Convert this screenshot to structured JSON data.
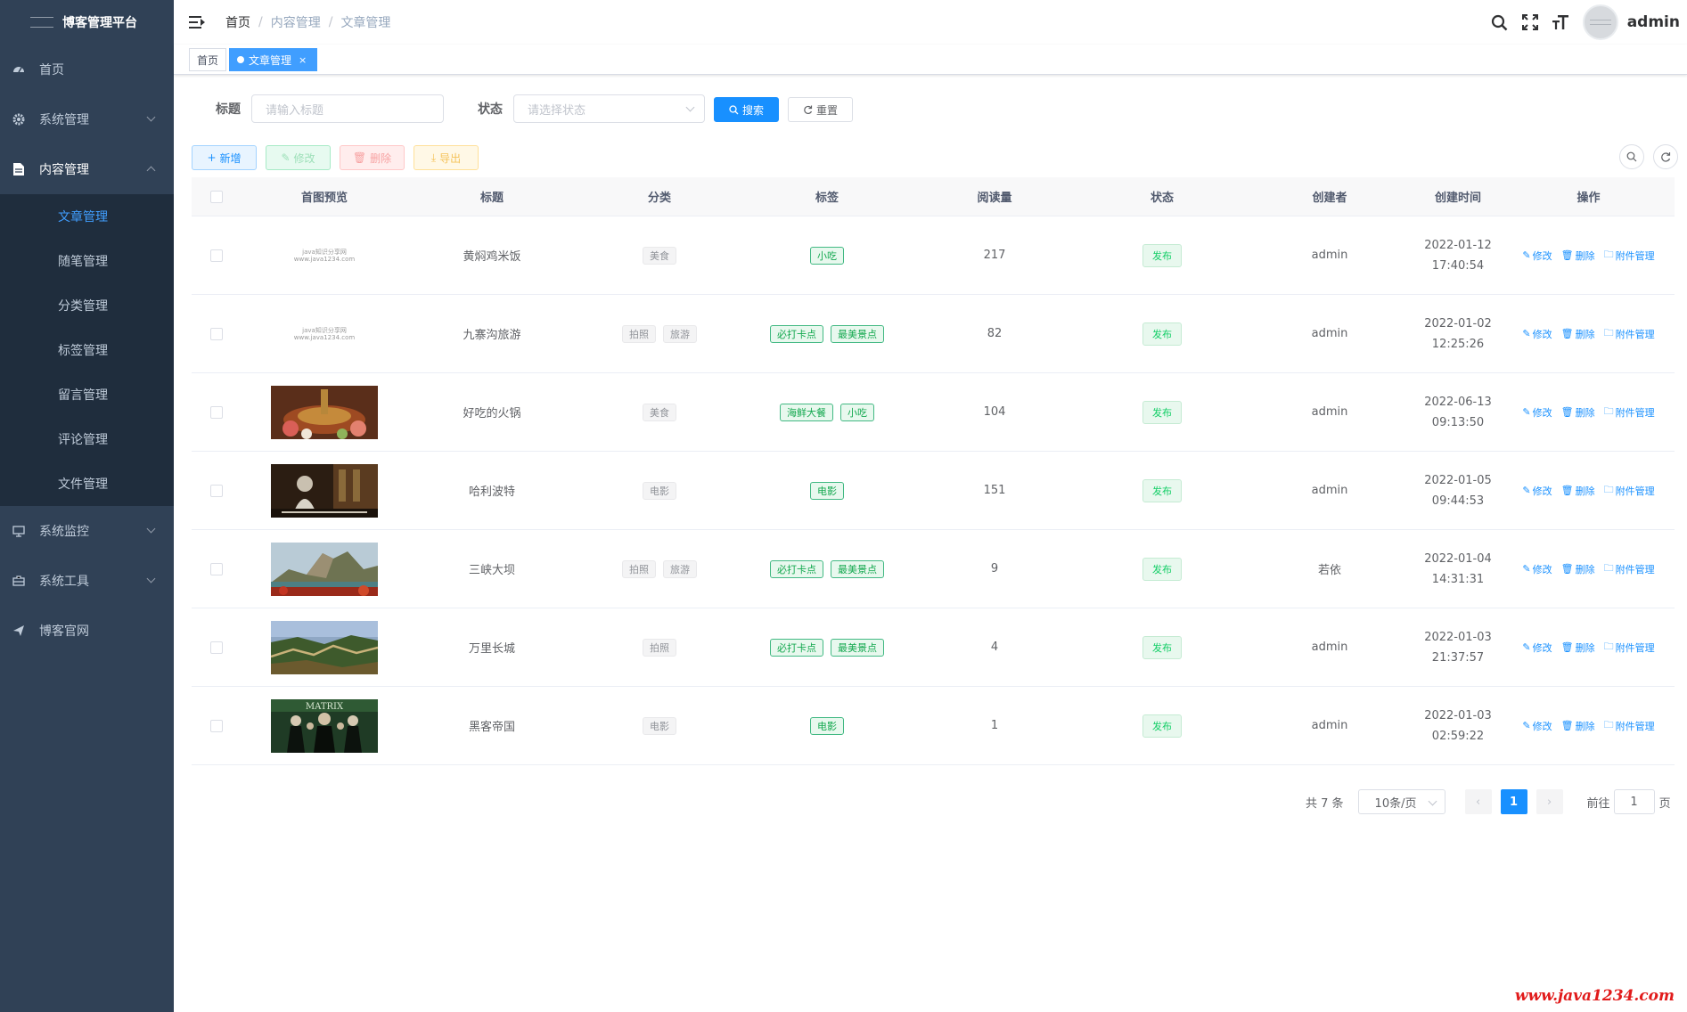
{
  "sidebar": {
    "title": "博客管理平台",
    "menu": [
      {
        "label": "首页",
        "icon": "dashboard-icon"
      },
      {
        "label": "系统管理",
        "icon": "gear-icon"
      },
      {
        "label": "内容管理",
        "icon": "document-icon"
      }
    ],
    "submenu": [
      "文章管理",
      "随笔管理",
      "分类管理",
      "标签管理",
      "留言管理",
      "评论管理",
      "文件管理"
    ],
    "menu_bottom": [
      {
        "label": "系统监控",
        "icon": "monitor-icon"
      },
      {
        "label": "系统工具",
        "icon": "toolbox-icon"
      },
      {
        "label": "博客官网",
        "icon": "send-icon"
      }
    ]
  },
  "navbar": {
    "breadcrumb": [
      "首页",
      "内容管理",
      "文章管理"
    ],
    "username": "admin"
  },
  "tags": {
    "home": "首页",
    "active": "文章管理",
    "close": "×"
  },
  "search": {
    "title_label": "标题",
    "title_placeholder": "请输入标题",
    "status_label": "状态",
    "status_placeholder": "请选择状态",
    "search_btn": "搜索",
    "reset_btn": "重置"
  },
  "toolbar": {
    "add": "新增",
    "edit": "修改",
    "delete": "删除",
    "export": "导出"
  },
  "table": {
    "headers": [
      "首图预览",
      "标题",
      "分类",
      "标签",
      "阅读量",
      "状态",
      "创建者",
      "创建时间",
      "操作"
    ],
    "rows": [
      {
        "title": "黄焖鸡米饭",
        "categories": [
          "美食"
        ],
        "tags": [
          "小吃"
        ],
        "reads": "217",
        "status": "发布",
        "creator": "admin",
        "date": "2022-01-12",
        "time": "17:40:54",
        "image": "placeholder"
      },
      {
        "title": "九寨沟旅游",
        "categories": [
          "拍照",
          "旅游"
        ],
        "tags": [
          "必打卡点",
          "最美景点"
        ],
        "reads": "82",
        "status": "发布",
        "creator": "admin",
        "date": "2022-01-02",
        "time": "12:25:26",
        "image": "placeholder"
      },
      {
        "title": "好吃的火锅",
        "categories": [
          "美食"
        ],
        "tags": [
          "海鲜大餐",
          "小吃"
        ],
        "reads": "104",
        "status": "发布",
        "creator": "admin",
        "date": "2022-06-13",
        "time": "09:13:50",
        "image": "hotpot"
      },
      {
        "title": "哈利波特",
        "categories": [
          "电影"
        ],
        "tags": [
          "电影"
        ],
        "reads": "151",
        "status": "发布",
        "creator": "admin",
        "date": "2022-01-05",
        "time": "09:44:53",
        "image": "harry"
      },
      {
        "title": "三峡大坝",
        "categories": [
          "拍照",
          "旅游"
        ],
        "tags": [
          "必打卡点",
          "最美景点"
        ],
        "reads": "9",
        "status": "发布",
        "creator": "若依",
        "date": "2022-01-04",
        "time": "14:31:31",
        "image": "mountain"
      },
      {
        "title": "万里长城",
        "categories": [
          "拍照"
        ],
        "tags": [
          "必打卡点",
          "最美景点"
        ],
        "reads": "4",
        "status": "发布",
        "creator": "admin",
        "date": "2022-01-03",
        "time": "21:37:57",
        "image": "wall"
      },
      {
        "title": "黑客帝国",
        "categories": [
          "电影"
        ],
        "tags": [
          "电影"
        ],
        "reads": "1",
        "status": "发布",
        "creator": "admin",
        "date": "2022-01-03",
        "time": "02:59:22",
        "image": "matrix"
      }
    ],
    "ops": [
      "修改",
      "删除",
      "附件管理"
    ],
    "placeholder_text": [
      "java知识分享网",
      "www.java1234.com"
    ],
    "matrix_text": "MATRIX"
  },
  "pagination": {
    "total": "共 7 条",
    "page_size": "10条/页",
    "current": "1",
    "goto": "前往",
    "goto_value": "1",
    "page_unit": "页"
  },
  "watermark": "www.java1234.com"
}
